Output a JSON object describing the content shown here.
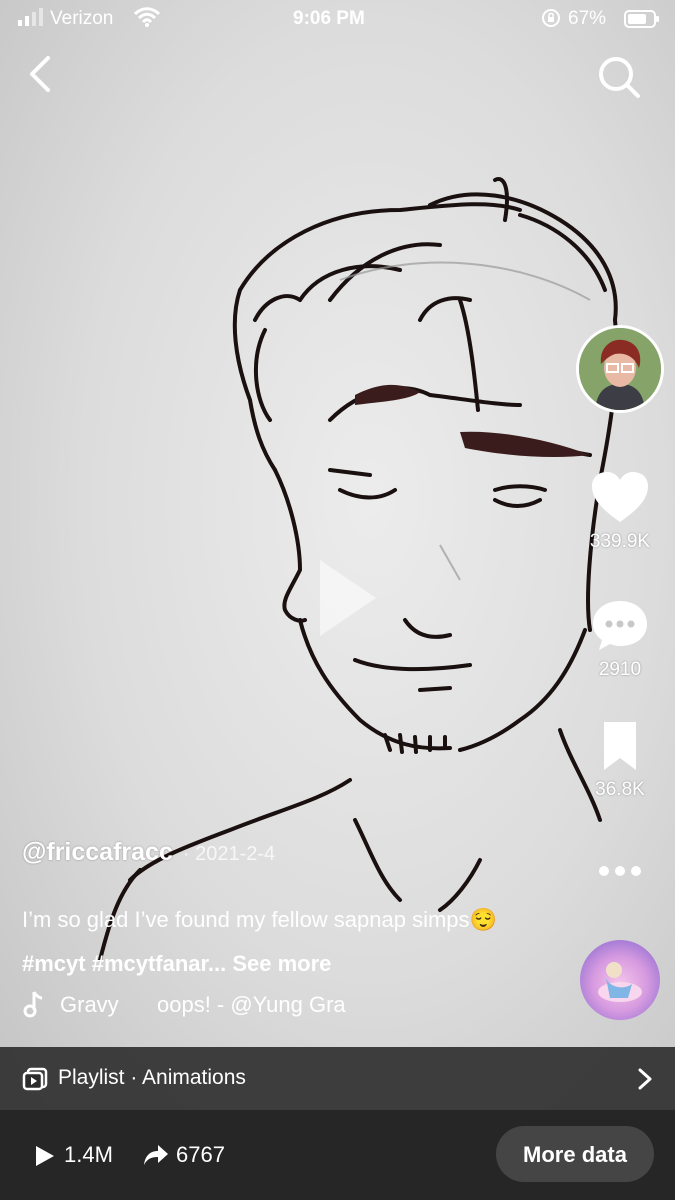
{
  "status_bar": {
    "carrier": "Verizon",
    "time": "9:06 PM",
    "battery_percent": "67%"
  },
  "video": {
    "like_count": "339.9K",
    "comment_count": "2910",
    "save_count": "36.8K"
  },
  "post": {
    "username": "@friccafracc",
    "date": "· 2021-2-4",
    "caption_text": "I’m so glad I’ve found my fellow sapnap simps",
    "caption_emoji": "😌",
    "caption_tags": "#mcyt #mcytfanar...",
    "see_more": "See more",
    "sound_part_a": "Gravy",
    "sound_part_b": "oops! - @Yung Gra"
  },
  "playlist": {
    "label": "Playlist · Animations"
  },
  "stats": {
    "views": "1.4M",
    "shares": "6767",
    "more_data_label": "More data"
  },
  "colors": {
    "background": "#d6d6d6",
    "stats_bar": "#262626",
    "playlist_bar": "#282828",
    "text": "#ffffff",
    "avatar_bg": "#86a36a"
  },
  "icons": [
    "back-icon",
    "search-icon",
    "play-icon",
    "heart-icon",
    "comment-icon",
    "bookmark-icon",
    "more-icon",
    "music-note-icon",
    "playlist-icon",
    "chevron-right-icon",
    "views-play-icon",
    "share-arrow-icon"
  ]
}
